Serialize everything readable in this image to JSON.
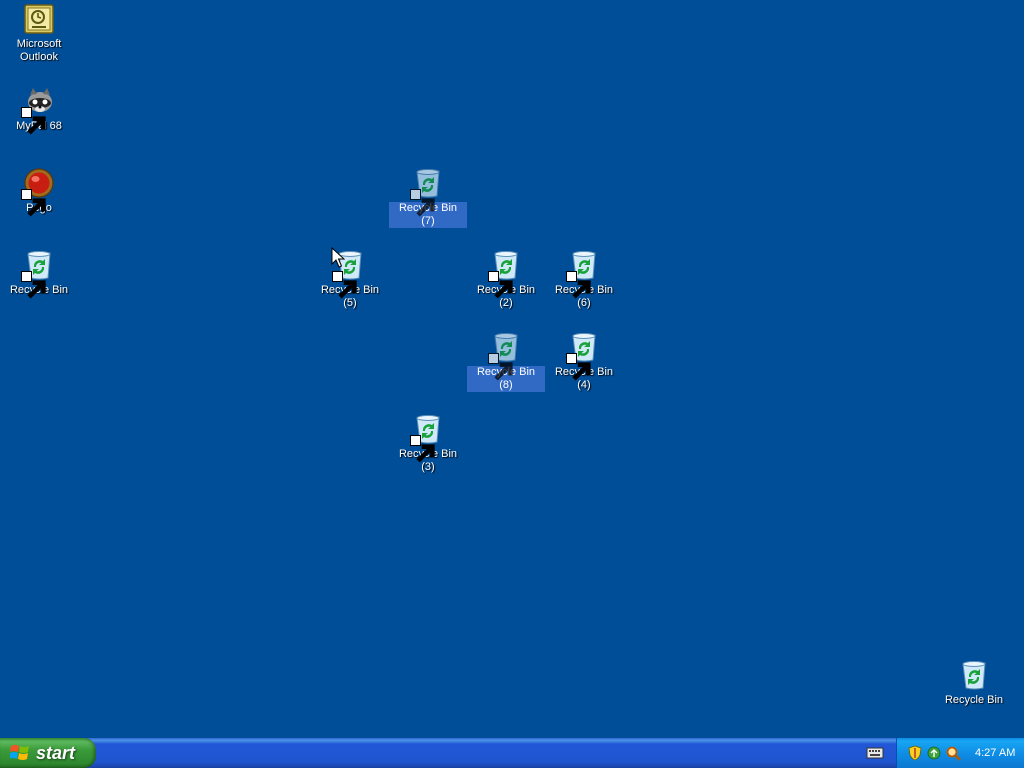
{
  "desktop": {
    "background": "#004e98",
    "icons": [
      {
        "label": "Microsoft\nOutlook",
        "icon": "outlook-icon",
        "shortcut": false,
        "selected": false
      },
      {
        "label": "MyPal 68",
        "icon": "mypal-icon",
        "shortcut": true,
        "selected": false
      },
      {
        "label": "Pego",
        "icon": "pego-icon",
        "shortcut": true,
        "selected": false
      },
      {
        "label": "Recycle Bin",
        "icon": "recycle-bin-icon",
        "shortcut": true,
        "selected": false
      },
      {
        "label": "Recycle Bin (7)",
        "icon": "recycle-bin-icon",
        "shortcut": true,
        "selected": true
      },
      {
        "label": "Recycle Bin (5)",
        "icon": "recycle-bin-icon",
        "shortcut": true,
        "selected": false
      },
      {
        "label": "Recycle Bin (2)",
        "icon": "recycle-bin-icon",
        "shortcut": true,
        "selected": false
      },
      {
        "label": "Recycle Bin (6)",
        "icon": "recycle-bin-icon",
        "shortcut": true,
        "selected": false
      },
      {
        "label": "Recycle Bin (8)",
        "icon": "recycle-bin-icon",
        "shortcut": true,
        "selected": true
      },
      {
        "label": "Recycle Bin (4)",
        "icon": "recycle-bin-icon",
        "shortcut": true,
        "selected": false
      },
      {
        "label": "Recycle Bin (3)",
        "icon": "recycle-bin-icon",
        "shortcut": true,
        "selected": false
      },
      {
        "label": "Recycle Bin",
        "icon": "recycle-bin-icon",
        "shortcut": false,
        "selected": false
      }
    ]
  },
  "taskbar": {
    "start_label": "start",
    "tray": {
      "icons": [
        "security-shield-icon",
        "network-icon",
        "search-icon"
      ],
      "clock": "4:27 AM"
    }
  }
}
